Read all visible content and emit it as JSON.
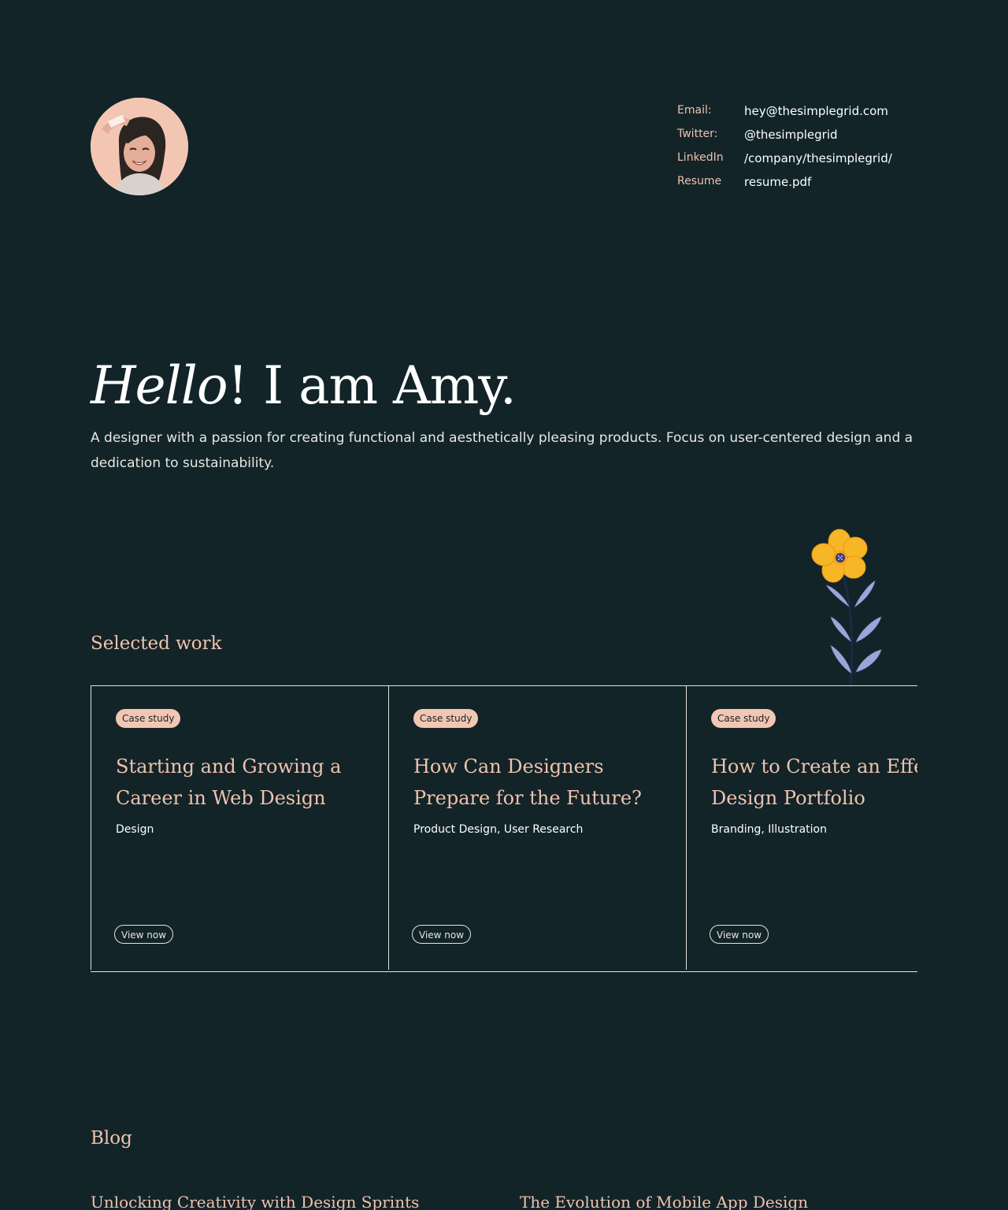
{
  "contact": [
    {
      "label": "Email:",
      "value": "hey@thesimplegrid.com"
    },
    {
      "label": "Twitter:",
      "value": "@thesimplegrid"
    },
    {
      "label": "LinkedIn",
      "value": "/company/thesimplegrid/"
    },
    {
      "label": "Resume",
      "value": "resume.pdf"
    }
  ],
  "hero": {
    "greeting": "Hello",
    "exclaim": "!",
    "name_line": " I am Amy.",
    "description": "A designer with a passion for creating functional and aesthetically pleasing products. Focus on user-centered design and a dedication to sustainability."
  },
  "work": {
    "title": "Selected work",
    "cards": [
      {
        "badge": "Case study",
        "title_line1": "Starting and Growing a",
        "title_line2": "Career in Web Design",
        "tags": "Design",
        "button": "View now"
      },
      {
        "badge": "Case study",
        "title_line1": "How Can Designers",
        "title_line2": "Prepare for the Future?",
        "tags": "Product Design, User Research",
        "button": "View now"
      },
      {
        "badge": "Case study",
        "title_line1": "How to Create an Effective",
        "title_line2": "Design Portfolio",
        "tags": "Branding, Illustration",
        "button": "View now"
      }
    ]
  },
  "blog": {
    "title": "Blog",
    "posts": [
      {
        "title": "Unlocking Creativity with Design Sprints"
      },
      {
        "title": "The Evolution of Mobile App Design"
      }
    ]
  },
  "colors": {
    "background": "#122428",
    "accent": "#f0c2ae",
    "badge": "#f3c6b4",
    "text": "#ffffff"
  },
  "icons": {
    "avatar": "profile-photo",
    "flower": "flower-illustration"
  }
}
